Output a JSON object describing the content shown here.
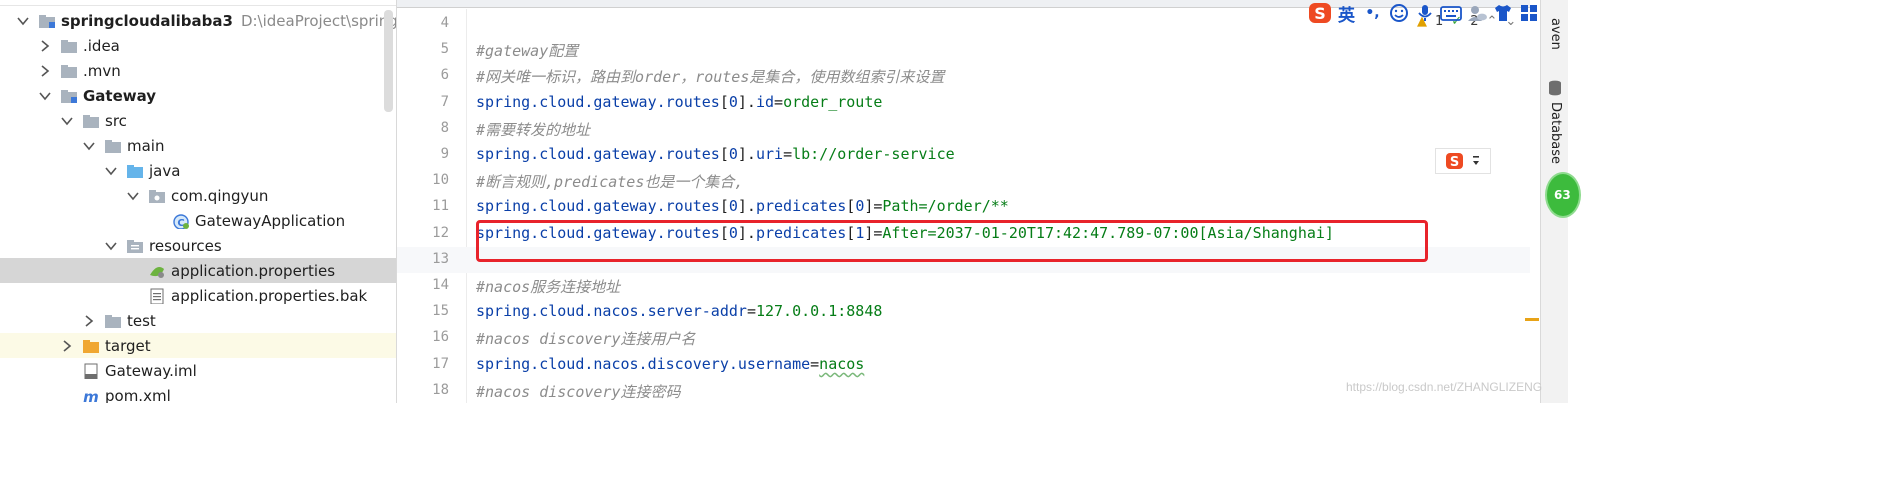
{
  "project_tree": {
    "items": [
      {
        "label": "springcloudalibaba3",
        "path": "D:\\ideaProject\\springclou",
        "bold": true,
        "chevron": "down",
        "icon": "module-folder-icon"
      },
      {
        "label": ".idea",
        "chevron": "right",
        "icon": "folder-icon"
      },
      {
        "label": ".mvn",
        "chevron": "right",
        "icon": "folder-icon"
      },
      {
        "label": "Gateway",
        "bold": true,
        "chevron": "down",
        "icon": "module-folder-icon"
      },
      {
        "label": "src",
        "chevron": "down",
        "icon": "folder-icon"
      },
      {
        "label": "main",
        "chevron": "down",
        "icon": "folder-icon"
      },
      {
        "label": "java",
        "chevron": "down",
        "icon": "source-folder-icon"
      },
      {
        "label": "com.qingyun",
        "chevron": "down",
        "icon": "package-icon"
      },
      {
        "label": "GatewayApplication",
        "chevron": "none",
        "icon": "spring-boot-class-icon"
      },
      {
        "label": "resources",
        "chevron": "down",
        "icon": "resources-folder-icon"
      },
      {
        "label": "application.properties",
        "chevron": "none",
        "icon": "spring-properties-icon",
        "state": "selected"
      },
      {
        "label": "application.properties.bak",
        "chevron": "none",
        "icon": "text-file-icon"
      },
      {
        "label": "test",
        "chevron": "right",
        "icon": "folder-icon"
      },
      {
        "label": "target",
        "chevron": "right",
        "icon": "excluded-folder-icon",
        "state": "highlighted"
      },
      {
        "label": "Gateway.iml",
        "chevron": "none",
        "icon": "iml-file-icon"
      },
      {
        "label": "pom.xml",
        "chevron": "none",
        "icon": "maven-file-icon"
      }
    ]
  },
  "editor": {
    "lines": [
      {
        "number": "4",
        "kind": "blank"
      },
      {
        "number": "5",
        "kind": "comment",
        "text": "#gateway配置"
      },
      {
        "number": "6",
        "kind": "comment",
        "text": "#网关唯一标识，路由到order，routes是集合，使用数组索引来设置"
      },
      {
        "number": "7",
        "kind": "code",
        "segments": [
          {
            "text": "spring.cloud.gateway.routes",
            "cls": "k"
          },
          {
            "text": "[",
            "cls": "p"
          },
          {
            "text": "0",
            "cls": "k"
          },
          {
            "text": "].",
            "cls": "p"
          },
          {
            "text": "id",
            "cls": "k"
          },
          {
            "text": "=",
            "cls": "p"
          },
          {
            "text": "order_route",
            "cls": "v"
          }
        ]
      },
      {
        "number": "8",
        "kind": "comment",
        "text": "#需要转发的地址"
      },
      {
        "number": "9",
        "kind": "code",
        "segments": [
          {
            "text": "spring.cloud.gateway.routes",
            "cls": "k"
          },
          {
            "text": "[",
            "cls": "p"
          },
          {
            "text": "0",
            "cls": "k"
          },
          {
            "text": "].",
            "cls": "p"
          },
          {
            "text": "uri",
            "cls": "k"
          },
          {
            "text": "=",
            "cls": "p"
          },
          {
            "text": "lb://order-service",
            "cls": "v"
          }
        ]
      },
      {
        "number": "10",
        "kind": "comment",
        "text": "#断言规则,predicates也是一个集合,"
      },
      {
        "number": "11",
        "kind": "code",
        "segments": [
          {
            "text": "spring.cloud.gateway.routes",
            "cls": "k"
          },
          {
            "text": "[",
            "cls": "p"
          },
          {
            "text": "0",
            "cls": "k"
          },
          {
            "text": "].",
            "cls": "p"
          },
          {
            "text": "predicates",
            "cls": "k"
          },
          {
            "text": "[",
            "cls": "p"
          },
          {
            "text": "0",
            "cls": "k"
          },
          {
            "text": "]",
            "cls": "p"
          },
          {
            "text": "=",
            "cls": "p"
          },
          {
            "text": "Path=/order/**",
            "cls": "v"
          }
        ]
      },
      {
        "number": "12",
        "kind": "code",
        "segments": [
          {
            "text": "spring.cloud.gateway.routes",
            "cls": "k"
          },
          {
            "text": "[",
            "cls": "p"
          },
          {
            "text": "0",
            "cls": "k"
          },
          {
            "text": "].",
            "cls": "p"
          },
          {
            "text": "predicates",
            "cls": "k"
          },
          {
            "text": "[",
            "cls": "p"
          },
          {
            "text": "1",
            "cls": "k"
          },
          {
            "text": "]",
            "cls": "p"
          },
          {
            "text": "=",
            "cls": "p"
          },
          {
            "text": "After=2037-01-20T17:42:47.789-07:00[Asia/Shanghai]",
            "cls": "v"
          }
        ]
      },
      {
        "number": "13",
        "kind": "blank",
        "current": true
      },
      {
        "number": "14",
        "kind": "comment",
        "text": "#nacos服务连接地址"
      },
      {
        "number": "15",
        "kind": "code",
        "segments": [
          {
            "text": "spring.cloud.nacos.server-addr",
            "cls": "k"
          },
          {
            "text": "=",
            "cls": "p"
          },
          {
            "text": "127.0.0.1:8848",
            "cls": "v"
          }
        ]
      },
      {
        "number": "16",
        "kind": "comment",
        "text": "#nacos discovery连接用户名"
      },
      {
        "number": "17",
        "kind": "code",
        "segments": [
          {
            "text": "spring.cloud.nacos.discovery.username",
            "cls": "k"
          },
          {
            "text": "=",
            "cls": "p"
          },
          {
            "text": "nacos",
            "cls": "v wavy"
          }
        ]
      },
      {
        "number": "18",
        "kind": "comment",
        "text": "#nacos discovery连接密码"
      }
    ],
    "inspection": {
      "warnings": "1",
      "weak_warnings": "2"
    }
  },
  "ime_toolbar": {
    "lang_label": "英",
    "punct_label": "•,"
  },
  "right_strip": {
    "maven_label": "aven",
    "database_label": "Database",
    "badge_label": "63"
  },
  "watermark": "https://blog.csdn.net/ZHANGLIZENG",
  "colors": {
    "keyword": "#0a3fa8",
    "value": "#067d17",
    "comment": "#8c8c8c",
    "highlight_box": "#e8232b",
    "selected_row": "#d6d6d6",
    "highlighted_row": "#fcfae6"
  }
}
